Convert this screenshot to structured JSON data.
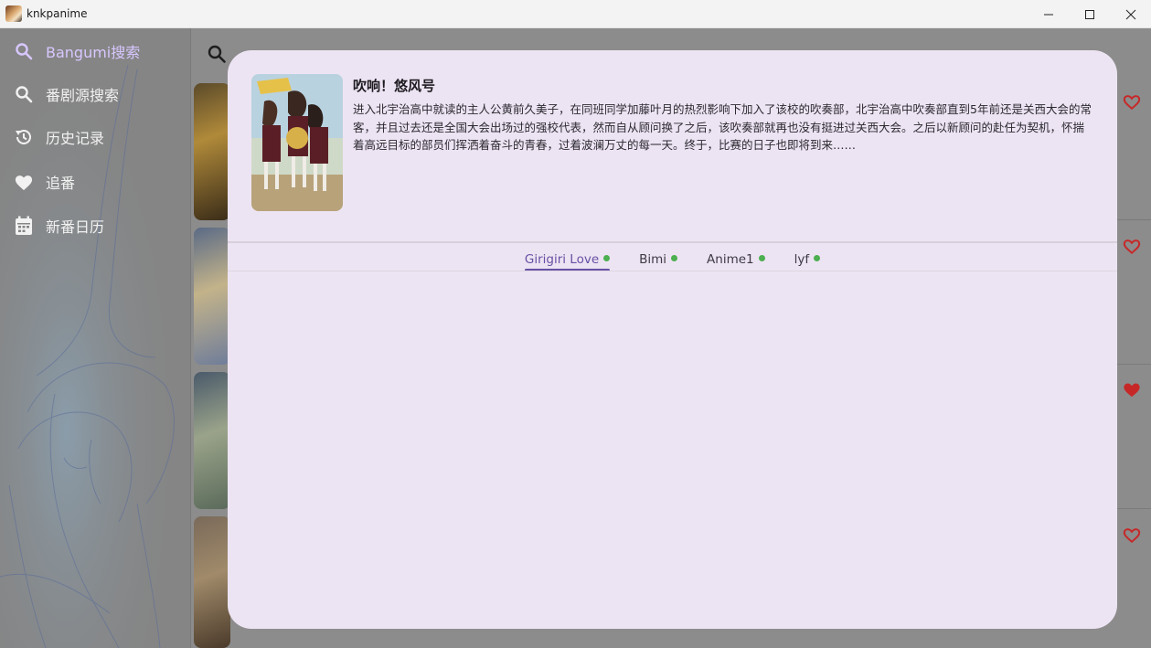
{
  "window": {
    "title": "knkpanime",
    "minimize_glyph": "—",
    "maximize_glyph": "☐",
    "close_glyph": "✕"
  },
  "sidebar": {
    "items": [
      {
        "label": "Bangumi搜索",
        "icon": "search-icon",
        "active": true
      },
      {
        "label": "番剧源搜索",
        "icon": "search-icon",
        "active": false
      },
      {
        "label": "历史记录",
        "icon": "history-icon",
        "active": false
      },
      {
        "label": "追番",
        "icon": "heart-icon",
        "active": false
      },
      {
        "label": "新番日历",
        "icon": "calendar-icon",
        "active": false
      }
    ]
  },
  "modal": {
    "title": "吹响！悠风号",
    "description": "进入北宇治高中就读的主人公黄前久美子，在同班同学加藤叶月的热烈影响下加入了该校的吹奏部，北宇治高中吹奏部直到5年前还是关西大会的常客，并且过去还是全国大会出场过的强校代表，然而自从顾问换了之后，该吹奏部就再也没有挺进过关西大会。之后以新顾问的赴任为契机，怀揣着高远目标的部员们挥洒着奋斗的青春，过着波澜万丈的每一天。终于，比赛的日子也即将到来……",
    "tabs": [
      {
        "label": "Girigiri Love",
        "active": true,
        "status": "online"
      },
      {
        "label": "Bimi",
        "active": false,
        "status": "online"
      },
      {
        "label": "Anime1",
        "active": false,
        "status": "online"
      },
      {
        "label": "lyf",
        "active": false,
        "status": "online"
      }
    ]
  },
  "colors": {
    "accent": "#6750a4",
    "status_online": "#4caf50",
    "modal_bg": "#ede4f3",
    "sidebar_active": "#d8c7ff",
    "heart_red": "#c62828"
  }
}
